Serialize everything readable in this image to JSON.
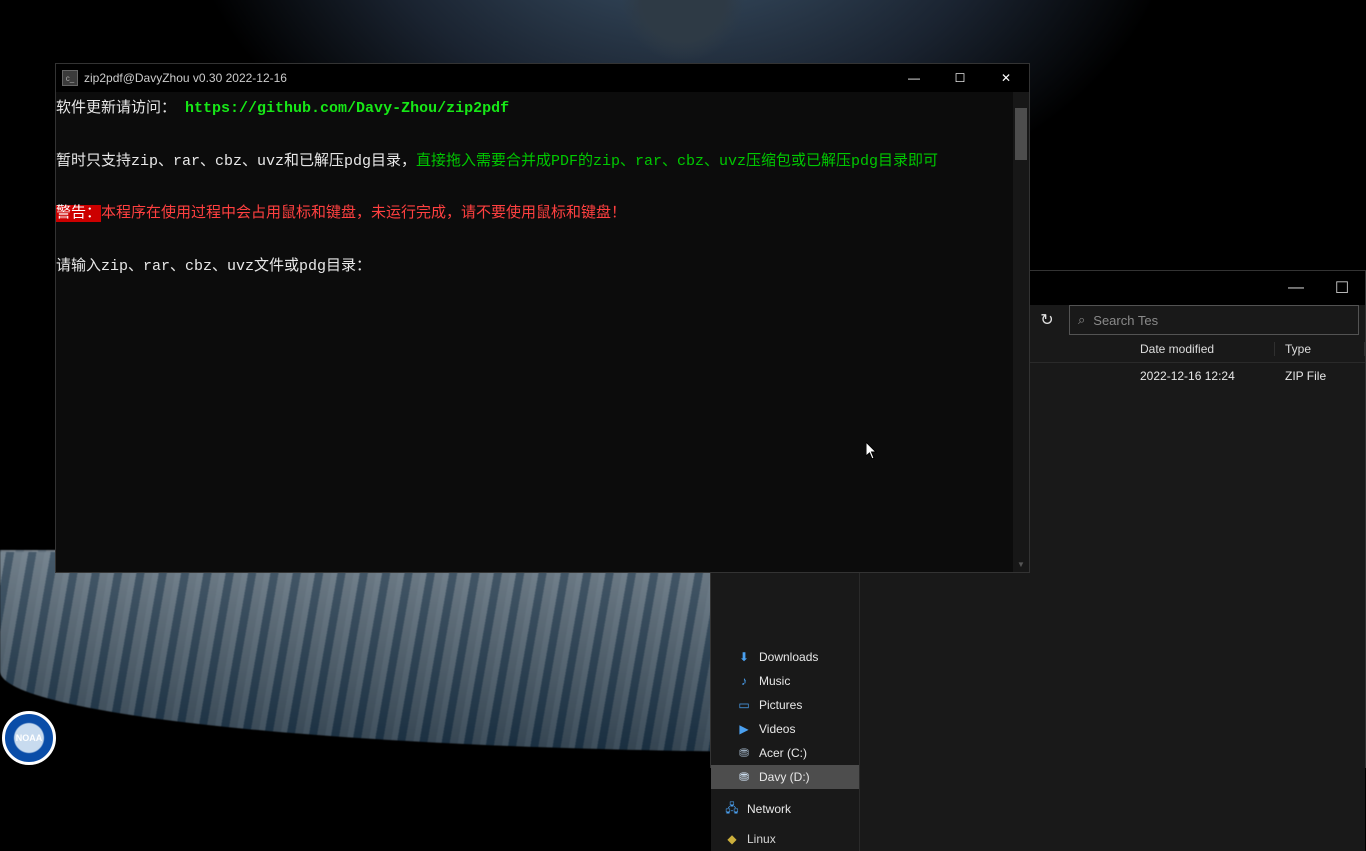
{
  "console": {
    "title": "zip2pdf@DavyZhou v0.30 2022-12-16",
    "lines": {
      "l1_prefix": "软件更新请访问：",
      "l1_link": "https://github.com/Davy-Zhou/zip2pdf",
      "l2_white": "暂时只支持zip、rar、cbz、uvz和已解压pdg目录，",
      "l2_green": "直接拖入需要合并成PDF的zip、rar、cbz、uvz压缩包或已解压pdg目录即可",
      "l3_warn_tag": "警告：",
      "l3_rest": "本程序在使用过程中会占用鼠标和键盘，未运行完成，请不要使用鼠标和键盘！",
      "l4": "请输入zip、rar、cbz、uvz文件或pdg目录："
    },
    "window_controls": {
      "minimize": "—",
      "maximize": "☐",
      "close": "✕"
    }
  },
  "explorer": {
    "window_controls": {
      "minimize": "—",
      "maximize": "☐"
    },
    "refresh_icon": "↻",
    "path_chevron": "⌄",
    "search_placeholder": "Search Tes",
    "search_icon": "⌕",
    "sidebar": {
      "downloads": "Downloads",
      "music": "Music",
      "pictures": "Pictures",
      "videos": "Videos",
      "drive_c": "Acer (C:)",
      "drive_d": "Davy (D:)",
      "network": "Network",
      "linux": "Linux"
    },
    "columns": {
      "date": "Date modified",
      "type": "Type"
    },
    "row1": {
      "date": "2022-12-16 12:24",
      "type": "ZIP File"
    }
  },
  "noaa_label": "NOAA"
}
